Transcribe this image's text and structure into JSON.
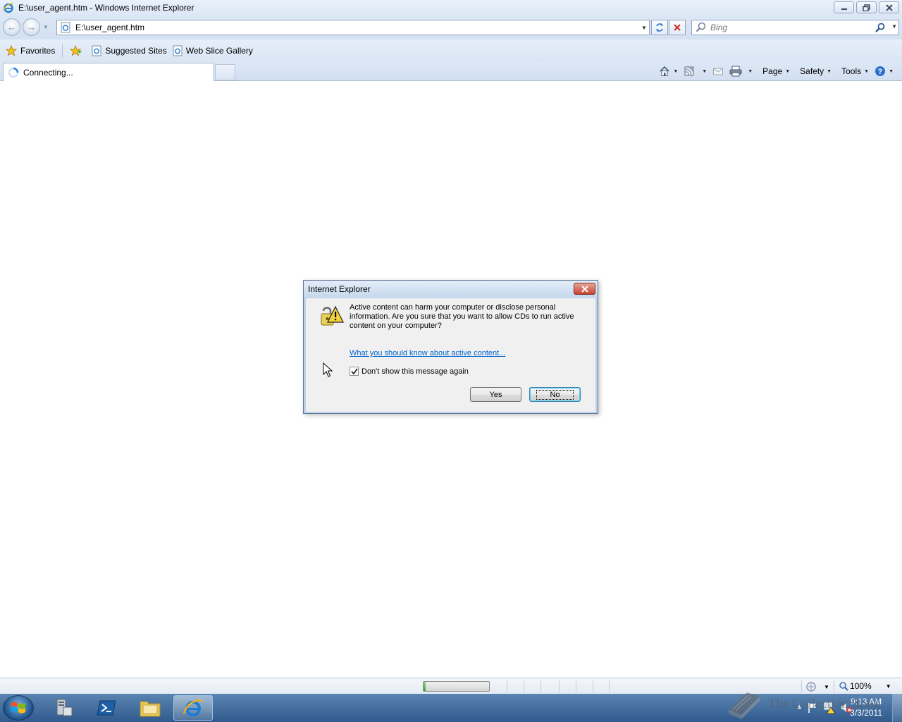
{
  "window": {
    "title": "E:\\user_agent.htm - Windows Internet Explorer"
  },
  "address_bar": {
    "url": "E:\\user_agent.htm"
  },
  "search": {
    "placeholder": "Bing"
  },
  "favorites_bar": {
    "favorites_label": "Favorites",
    "items": [
      {
        "label": "Suggested Sites"
      },
      {
        "label": "Web Slice Gallery"
      }
    ]
  },
  "tab": {
    "label": "Connecting..."
  },
  "command_bar": {
    "page_label": "Page",
    "safety_label": "Safety",
    "tools_label": "Tools"
  },
  "dialog": {
    "title": "Internet Explorer",
    "message": "Active content can harm your computer or disclose personal information. Are you sure that you want to allow CDs to run active content on your computer?",
    "link": "What you should know about active content...",
    "checkbox_label": "Don't show this message again",
    "checkbox_checked": true,
    "yes_label": "Yes",
    "no_label": "No"
  },
  "status_bar": {
    "zoom": "100%",
    "progress_fraction": 0.03
  },
  "taskbar": {
    "time": "9:13 AM",
    "date": "3/3/2011"
  },
  "watermark": {
    "text": "The Collection Book"
  },
  "colors": {
    "chrome_blue": "#dce7f5",
    "link_blue": "#0066cc",
    "taskbar": "#3b6797"
  }
}
